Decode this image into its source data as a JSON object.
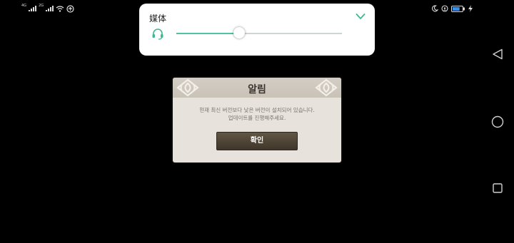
{
  "status_bar": {
    "signal_1_label": "4G",
    "signal_2_label": "2G",
    "battery_level": 0.75,
    "icons": [
      "signal-icon",
      "signal-icon",
      "wifi-icon",
      "hotspot-icon",
      "moon-icon",
      "alarm-icon",
      "battery-icon",
      "charging-icon"
    ]
  },
  "volume_panel": {
    "title": "媒体",
    "level": 0.38,
    "accent_color": "#4fc3a1",
    "icons": [
      "headset-icon",
      "chevron-down-icon"
    ]
  },
  "dialog": {
    "title": "알림",
    "message_line1": "현재 최신 버전보다 낮은 버전이 설치되어 있습니다.",
    "message_line2": "업데이트를 진행해주세요.",
    "confirm_label": "확인"
  },
  "navigation": {
    "icons": [
      "back-icon",
      "home-icon",
      "recent-apps-icon"
    ]
  }
}
